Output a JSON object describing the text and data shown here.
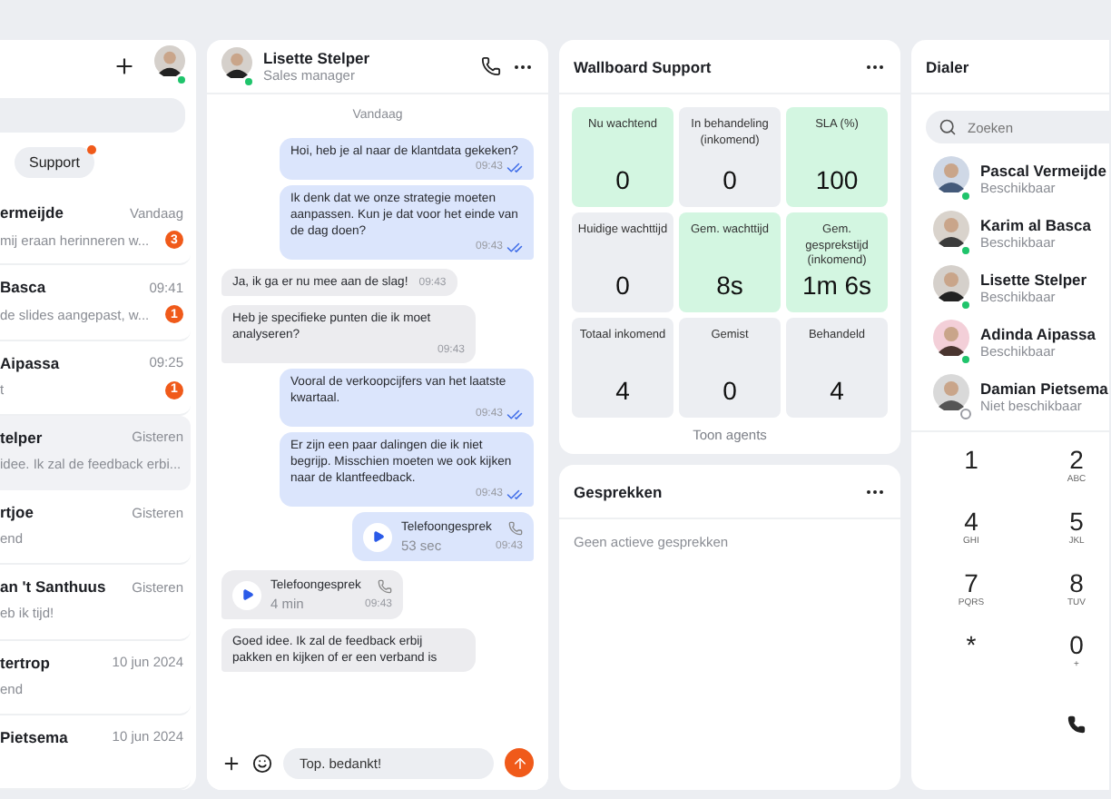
{
  "conversations": {
    "chips": [
      {
        "label": "Support",
        "unread": true
      }
    ],
    "items": [
      {
        "name": "ermeijde",
        "time": "Vandaag",
        "preview": " mij eraan herinneren w...",
        "unread": "3",
        "selected": false
      },
      {
        "name": "Basca",
        "time": "09:41",
        "preview": "de slides aangepast, w...",
        "unread": "1",
        "selected": false
      },
      {
        "name": "Aipassa",
        "time": "09:25",
        "preview": "t",
        "unread": "1",
        "selected": false
      },
      {
        "name": "telper",
        "time": "Gisteren",
        "preview": "idee. Ik zal de feedback erbi...",
        "selected": true
      },
      {
        "name": "rtjoe",
        "time": "Gisteren",
        "preview": "end",
        "selected": false
      },
      {
        "name": "an 't Santhuus",
        "time": "Gisteren",
        "preview": "eb ik tijd!",
        "selected": false
      },
      {
        "name": "tertrop",
        "time": "10 jun 2024",
        "preview": "end",
        "selected": false
      },
      {
        "name": "Pietsema",
        "time": "10 jun 2024",
        "selected": false
      }
    ]
  },
  "chat": {
    "contact": {
      "name": "Lisette Stelper",
      "role": "Sales manager",
      "online": true
    },
    "date": "Vandaag",
    "messages": [
      {
        "kind": "text",
        "outgoing": true,
        "text": "Hoi, heb je al naar de klantdata gekeken?",
        "time": "09:43",
        "read": true
      },
      {
        "kind": "text",
        "outgoing": true,
        "text": "Ik denk dat we onze strategie moeten aanpassen. Kun je dat voor het einde van de dag doen?",
        "time": "09:43",
        "read": true
      },
      {
        "kind": "text",
        "outgoing": false,
        "text": "Ja, ik ga er nu mee aan de slag!",
        "time": "09:43"
      },
      {
        "kind": "text",
        "outgoing": false,
        "text": "Heb je specifieke punten die ik moet analyseren?",
        "time": "09:43"
      },
      {
        "kind": "text",
        "outgoing": true,
        "text": "Vooral de verkoopcijfers van het laatste kwartaal.",
        "time": "09:43",
        "read": true
      },
      {
        "kind": "text",
        "outgoing": true,
        "text": "Er zijn een paar dalingen die ik niet begrijp. Misschien moeten we ook kijken naar de klantfeedback.",
        "time": "09:43",
        "read": true
      },
      {
        "kind": "call",
        "outgoing": true,
        "text": "Telefoongesprek",
        "duration": "53 sec",
        "time": "09:43"
      },
      {
        "kind": "call",
        "outgoing": false,
        "text": "Telefoongesprek",
        "duration": "4 min",
        "time": "09:43"
      },
      {
        "kind": "text",
        "outgoing": false,
        "text": "Goed idee. Ik zal de feedback erbij pakken en kijken of er een verband is"
      }
    ],
    "composer": {
      "value": "Top. bedankt!"
    }
  },
  "wallboard": {
    "title": "Wallboard Support",
    "tiles": [
      {
        "label": "Nu wachtend",
        "value": "0",
        "highlighted": true
      },
      {
        "label": "In behandeling (inkomend)",
        "value": "0",
        "highlighted": false
      },
      {
        "label": "SLA (%)",
        "value": "100",
        "highlighted": true
      },
      {
        "label": "Huidige wachttijd",
        "value": "0",
        "highlighted": false
      },
      {
        "label": "Gem. wachttijd",
        "value": "8s",
        "highlighted": true
      },
      {
        "label": "Gem. gesprekstijd (inkomend)",
        "value": "1m 6s",
        "highlighted": true
      },
      {
        "label": "Totaal inkomend",
        "value": "4",
        "highlighted": false
      },
      {
        "label": "Gemist",
        "value": "0",
        "highlighted": false
      },
      {
        "label": "Behandeld",
        "value": "4",
        "highlighted": false
      }
    ],
    "footer_link": "Toon agents"
  },
  "calls": {
    "title": "Gesprekken",
    "empty_text": "Geen actieve gesprekken"
  },
  "dialer": {
    "title": "Dialer",
    "search": {
      "placeholder": "Zoeken"
    },
    "contacts": [
      {
        "name": "Pascal Vermeijde",
        "status": "Beschikbaar",
        "available": true
      },
      {
        "name": "Karim al Basca",
        "status": "Beschikbaar",
        "available": true
      },
      {
        "name": "Lisette Stelper",
        "status": "Beschikbaar",
        "available": true
      },
      {
        "name": "Adinda Aipassa",
        "status": "Beschikbaar",
        "available": true
      },
      {
        "name": "Damian Pietsema",
        "status": "Niet beschikbaar",
        "available": false
      }
    ],
    "keys": [
      {
        "kind": "digit",
        "digit": "1"
      },
      {
        "kind": "digit",
        "digit": "2",
        "letters": "ABC"
      },
      {
        "kind": "digit",
        "digit": "4",
        "letters": "GHI"
      },
      {
        "kind": "digit",
        "digit": "5",
        "letters": "JKL"
      },
      {
        "kind": "digit",
        "digit": "7",
        "letters": "PQRS"
      },
      {
        "kind": "digit",
        "digit": "8",
        "letters": "TUV"
      },
      {
        "kind": "digit",
        "digit": "*"
      },
      {
        "kind": "digit",
        "digit": "0",
        "letters": "+"
      },
      {
        "kind": "call"
      }
    ]
  }
}
